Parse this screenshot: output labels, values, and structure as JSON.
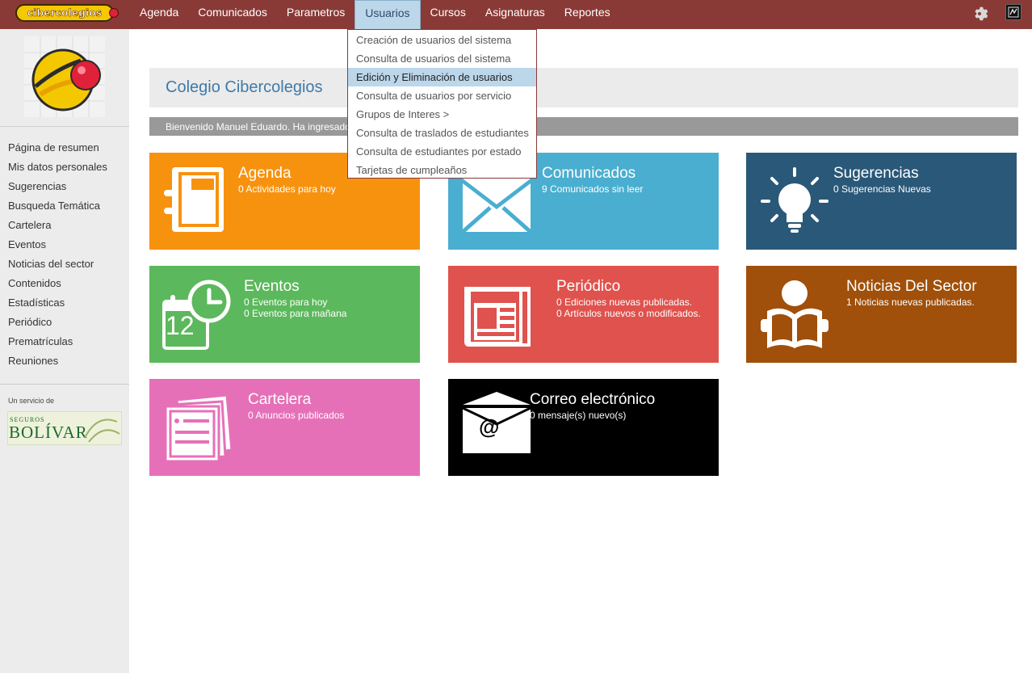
{
  "topbar": {
    "logo_text": "cibercolegios",
    "nav": [
      "Agenda",
      "Comunicados",
      "Parametros",
      "Usuarios",
      "Cursos",
      "Asignaturas",
      "Reportes"
    ],
    "active": "Usuarios",
    "color": "#8a3a36"
  },
  "dropdown": {
    "items": [
      "Creación de usuarios del sistema",
      "Consulta de usuarios del sistema",
      "Edición y Eliminación de usuarios",
      "Consulta de usuarios por servicio",
      "Grupos de Interes >",
      "Consulta de traslados de estudiantes",
      "Consulta de estudiantes por estado",
      "Tarjetas de cumpleaños"
    ],
    "highlighted": "Edición y Eliminación de usuarios"
  },
  "sidebar": {
    "items": [
      "Página de resumen",
      "Mis datos personales",
      "Sugerencias",
      "Busqueda Temática",
      "Cartelera",
      "Eventos",
      "Noticias del sector",
      "Contenidos",
      "Estadísticas",
      "Periódico",
      "Prematrículas",
      "Reuniones"
    ],
    "service_label": "Un servicio de",
    "sponsor_top": "SEGUROS",
    "sponsor_name": "BOLÍVAR"
  },
  "header": {
    "title": "Colegio Cibercolegios",
    "welcome": "Bienvenido Manuel Eduardo. Ha ingresado"
  },
  "tiles": {
    "agenda": {
      "title": "Agenda",
      "lines": [
        "0 Actividades para hoy"
      ],
      "color": "#f7920f",
      "icon": "notebook-icon"
    },
    "comunicados": {
      "title": "Comunicados",
      "lines": [
        "9 Comunicados sin leer"
      ],
      "color": "#4aaed0",
      "icon": "envelope-icon"
    },
    "sugerencias": {
      "title": "Sugerencias",
      "lines": [
        "0 Sugerencias Nuevas"
      ],
      "color": "#2a5878",
      "icon": "lightbulb-icon"
    },
    "eventos": {
      "title": "Eventos",
      "lines": [
        "0 Eventos para hoy",
        "0 Eventos para mañana"
      ],
      "color": "#5cb85c",
      "icon": "calendar-clock-icon",
      "icon_number": "12"
    },
    "periodico": {
      "title": "Periódico",
      "lines": [
        "0 Ediciones nuevas publicadas.",
        "0 Artículos nuevos o modificados."
      ],
      "color": "#e0524d",
      "icon": "newspaper-icon"
    },
    "noticias": {
      "title": "Noticias Del Sector",
      "lines": [
        "1 Noticias nuevas publicadas."
      ],
      "color": "#a0500a",
      "icon": "reader-icon"
    },
    "cartelera": {
      "title": "Cartelera",
      "lines": [
        "0 Anuncios publicados"
      ],
      "color": "#e670b8",
      "icon": "notices-icon"
    },
    "correo": {
      "title": "Correo electrónico",
      "lines": [
        "0 mensaje(s) nuevo(s)"
      ],
      "color": "#000000",
      "icon": "mail-at-icon",
      "icon_symbol": "@"
    }
  }
}
